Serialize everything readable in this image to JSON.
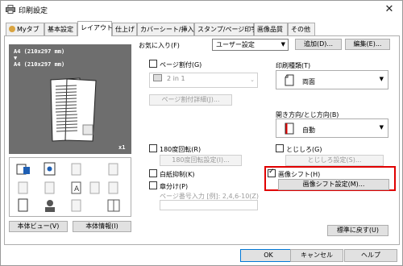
{
  "window": {
    "title": "印刷設定",
    "close_glyph": "✕"
  },
  "tabs": [
    {
      "label": "Myタブ"
    },
    {
      "label": "基本設定"
    },
    {
      "label": "レイアウト"
    },
    {
      "label": "仕上げ"
    },
    {
      "label": "カバーシート/挿入紙"
    },
    {
      "label": "スタンプ/ページ印字"
    },
    {
      "label": "画像品質"
    },
    {
      "label": "その他"
    }
  ],
  "preview": {
    "line1": "A4 (210x297 mm)",
    "arrow": "▼",
    "line2": "A4 (210x297 mm)",
    "copies": "x1"
  },
  "favorites": {
    "label": "お気に入り(F)",
    "value": "ユーザー設定",
    "add_button": "追加(D)...",
    "edit_button": "編集(E)..."
  },
  "layout": {
    "nup_checkbox": "ページ割付(G)",
    "nup_value": "2 in 1",
    "nup_detail_button": "ページ割付詳細(J)...",
    "rotate_checkbox": "180度回転(R)",
    "rotate_settings_button": "180度回転設定(I)...",
    "skip_blank_checkbox": "白紙抑制(K)",
    "chapter_checkbox": "章分け(P)",
    "page_number_label": "ページ番号入力 [例]: 2,4,6-10(Z)",
    "page_number_value": ""
  },
  "print_type": {
    "label": "印刷種類(T)",
    "value": "両面"
  },
  "binding": {
    "label": "開き方向/とじ方向(B)",
    "value": "自動"
  },
  "margin": {
    "checkbox": "とじしろ(G)",
    "settings_button": "とじしろ設定(S)..."
  },
  "image_shift": {
    "checkbox": "画像シフト(H)",
    "checked": true,
    "settings_button": "画像シフト設定(M)..."
  },
  "left_buttons": {
    "view": "本体ビュー(V)",
    "info": "本体情報(I)"
  },
  "default_button": "標準に戻す(U)",
  "dialog": {
    "ok": "OK",
    "cancel": "キャンセル",
    "help": "ヘルプ"
  },
  "colors": {
    "highlight": "#e00000",
    "preview_bg": "#6e6e6e",
    "accent_blue": "#1e5fb4"
  }
}
